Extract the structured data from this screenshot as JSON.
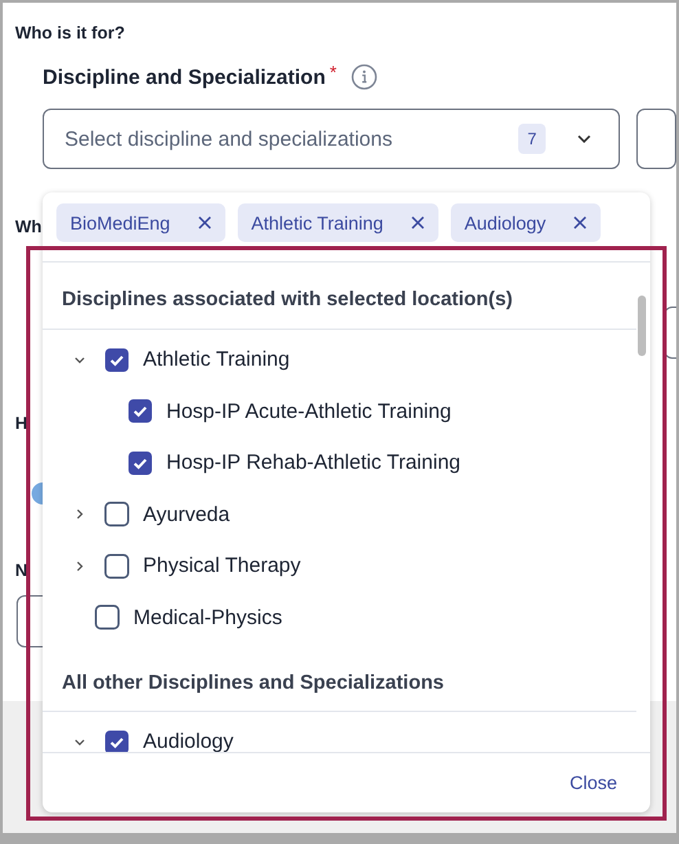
{
  "section_title": "Who is it for?",
  "field": {
    "label": "Discipline and Specialization",
    "required_mark": "*",
    "placeholder": "Select discipline and specializations",
    "count": "7"
  },
  "background": {
    "labels": [
      "Wh",
      "H",
      "N"
    ],
    "radio": {
      "selected": true
    }
  },
  "dropdown": {
    "chips": [
      {
        "label": "BioMediEng"
      },
      {
        "label": "Athletic Training"
      },
      {
        "label": "Audiology"
      }
    ],
    "groups": [
      {
        "heading": "Disciplines associated with selected location(s)",
        "items": [
          {
            "label": "Athletic Training",
            "checked": true,
            "expanded": true,
            "children": [
              {
                "label": "Hosp-IP Acute-Athletic Training",
                "checked": true
              },
              {
                "label": "Hosp-IP Rehab-Athletic Training",
                "checked": true
              }
            ]
          },
          {
            "label": "Ayurveda",
            "checked": false,
            "expanded": false
          },
          {
            "label": "Physical Therapy",
            "checked": false,
            "expanded": false
          },
          {
            "label": "Medical-Physics",
            "checked": false
          }
        ]
      },
      {
        "heading": "All other Disciplines and Specializations",
        "items": [
          {
            "label": "Audiology",
            "checked": true,
            "expanded": true
          }
        ]
      }
    ],
    "close": "Close"
  }
}
